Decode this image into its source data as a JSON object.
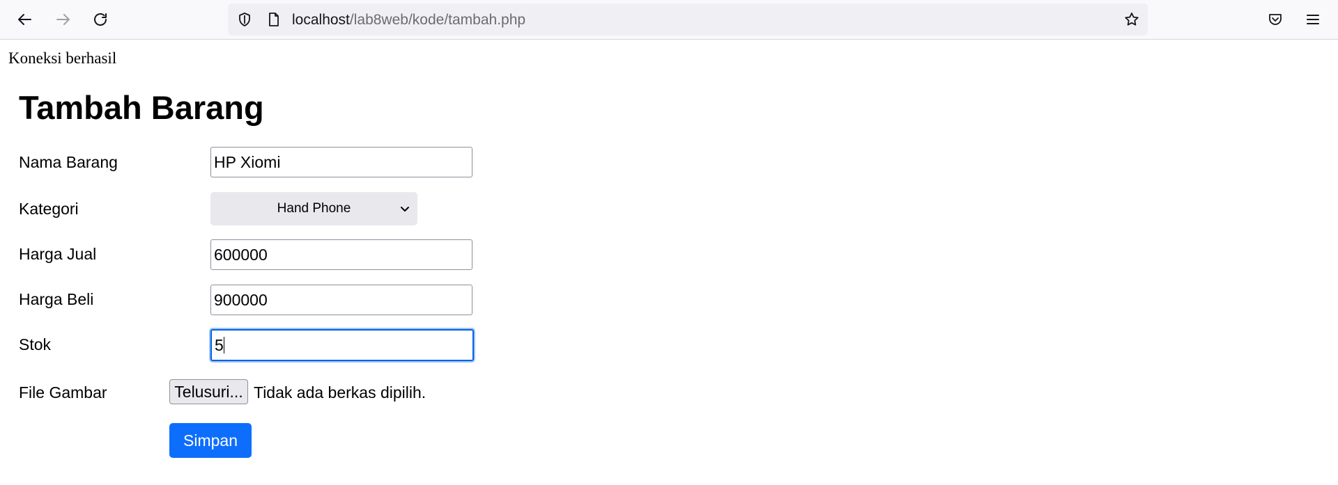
{
  "browser": {
    "url_host": "localhost",
    "url_path": "/lab8web/kode/tambah.php",
    "icons": [
      "back-icon",
      "forward-icon",
      "reload-icon",
      "shield-icon",
      "page-icon",
      "star-icon",
      "pocket-icon",
      "menu-icon"
    ]
  },
  "page": {
    "connection_message": "Koneksi berhasil",
    "title": "Tambah Barang"
  },
  "form": {
    "nama_label": "Nama Barang",
    "nama_value": "HP Xiomi",
    "kategori_label": "Kategori",
    "kategori_value": "Hand Phone",
    "harga_jual_label": "Harga Jual",
    "harga_jual_value": "600000",
    "harga_beli_label": "Harga Beli",
    "harga_beli_value": "900000",
    "stok_label": "Stok",
    "stok_value": "5",
    "file_label": "File Gambar",
    "file_button": "Telusuri...",
    "file_status": "Tidak ada berkas dipilih.",
    "submit_label": "Simpan"
  },
  "colors": {
    "submit_bg": "#0d6efd",
    "focus_border": "#0061e0"
  }
}
